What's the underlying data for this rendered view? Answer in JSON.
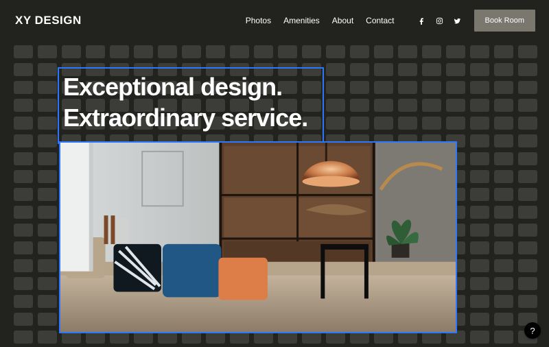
{
  "header": {
    "brand": "XY DESIGN",
    "nav": [
      "Photos",
      "Amenities",
      "About",
      "Contact"
    ],
    "social_icons": [
      "facebook",
      "instagram",
      "twitter"
    ],
    "cta_label": "Book Room"
  },
  "hero": {
    "headline_line1": "Exceptional design.",
    "headline_line2": "Extraordinary service.",
    "image_alt": "Modern interior with couch, cushions, copper lamp and wooden shelving"
  },
  "editor": {
    "selected_elements": [
      "headline-box",
      "hero-image"
    ],
    "grid_tiles_visible": true
  },
  "fab": {
    "help_label": "?"
  },
  "colors": {
    "page_bg": "#22231f",
    "tile": "#3c3d39",
    "selection": "#2b78ff",
    "cta_bg": "#7a776f"
  }
}
